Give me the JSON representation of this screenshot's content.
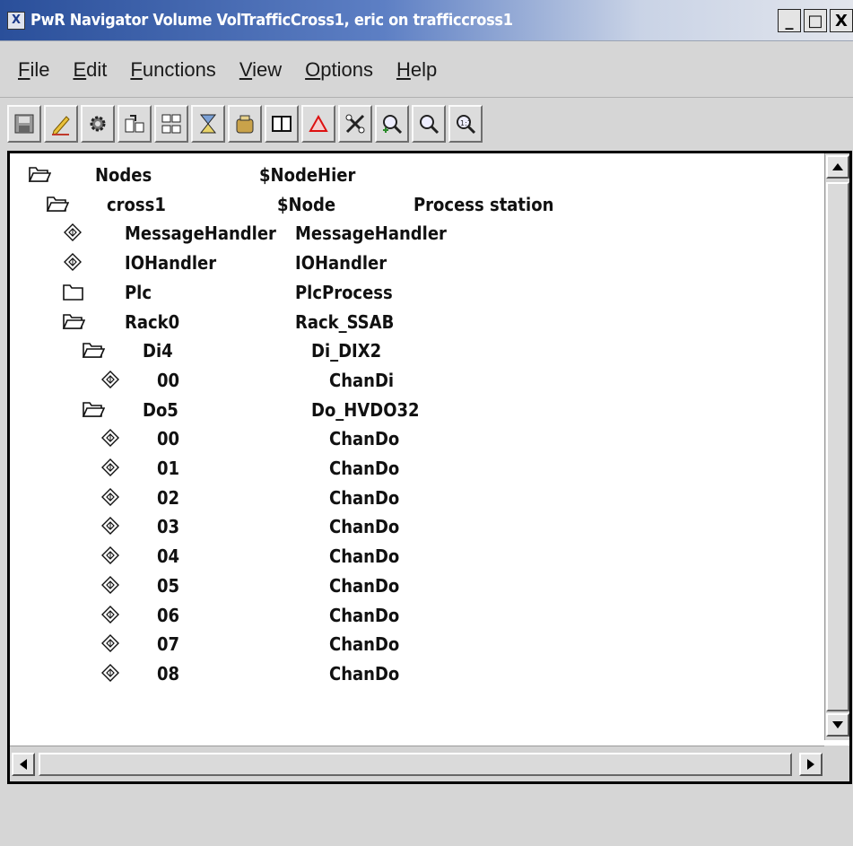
{
  "window": {
    "title": "PwR Navigator Volume VolTrafficCross1, eric on trafficcross1",
    "icon": "x-app-icon",
    "minimize": "_",
    "maximize": "□",
    "close": "X"
  },
  "menu": [
    {
      "underline": "F",
      "rest": "ile"
    },
    {
      "underline": "E",
      "rest": "dit"
    },
    {
      "underline": "F",
      "rest": "unctions"
    },
    {
      "underline": "V",
      "rest": "iew"
    },
    {
      "underline": "O",
      "rest": "ptions"
    },
    {
      "underline": "H",
      "rest": "elp"
    }
  ],
  "toolbar": [
    {
      "icon": "save-icon"
    },
    {
      "icon": "edit-pencil-icon"
    },
    {
      "icon": "gear-icon"
    },
    {
      "icon": "open-object-icon"
    },
    {
      "icon": "hierarchy-icon"
    },
    {
      "icon": "build-icon"
    },
    {
      "icon": "bucket-icon"
    },
    {
      "icon": "split-view-icon"
    },
    {
      "icon": "triangle-warning-icon"
    },
    {
      "icon": "tools-icon"
    },
    {
      "icon": "zoom-in-icon"
    },
    {
      "icon": "zoom-out-icon"
    },
    {
      "icon": "zoom-reset-icon"
    }
  ],
  "tree": [
    {
      "level": 0,
      "icon": "folder-open-icon",
      "name": "Nodes",
      "class": "$NodeHier",
      "desc": ""
    },
    {
      "level": 1,
      "icon": "folder-open-icon",
      "name": "cross1",
      "class": "$Node",
      "desc": "Process station"
    },
    {
      "level": 2,
      "icon": "leaf-object-icon",
      "name": "MessageHandler",
      "class": "MessageHandler",
      "desc": ""
    },
    {
      "level": 2,
      "icon": "leaf-object-icon",
      "name": "IOHandler",
      "class": "IOHandler",
      "desc": ""
    },
    {
      "level": 2,
      "icon": "folder-closed-icon",
      "name": "Plc",
      "class": "PlcProcess",
      "desc": ""
    },
    {
      "level": 2,
      "icon": "folder-open-icon",
      "name": "Rack0",
      "class": "Rack_SSAB",
      "desc": ""
    },
    {
      "level": 3,
      "icon": "folder-open-icon",
      "name": "Di4",
      "class": "Di_DIX2",
      "desc": ""
    },
    {
      "level": 4,
      "icon": "leaf-object-icon",
      "name": "00",
      "class": "ChanDi",
      "desc": ""
    },
    {
      "level": 3,
      "icon": "folder-open-icon",
      "name": "Do5",
      "class": "Do_HVDO32",
      "desc": ""
    },
    {
      "level": 4,
      "icon": "leaf-object-icon",
      "name": "00",
      "class": "ChanDo",
      "desc": ""
    },
    {
      "level": 4,
      "icon": "leaf-object-icon",
      "name": "01",
      "class": "ChanDo",
      "desc": ""
    },
    {
      "level": 4,
      "icon": "leaf-object-icon",
      "name": "02",
      "class": "ChanDo",
      "desc": ""
    },
    {
      "level": 4,
      "icon": "leaf-object-icon",
      "name": "03",
      "class": "ChanDo",
      "desc": ""
    },
    {
      "level": 4,
      "icon": "leaf-object-icon",
      "name": "04",
      "class": "ChanDo",
      "desc": ""
    },
    {
      "level": 4,
      "icon": "leaf-object-icon",
      "name": "05",
      "class": "ChanDo",
      "desc": ""
    },
    {
      "level": 4,
      "icon": "leaf-object-icon",
      "name": "06",
      "class": "ChanDo",
      "desc": ""
    },
    {
      "level": 4,
      "icon": "leaf-object-icon",
      "name": "07",
      "class": "ChanDo",
      "desc": ""
    },
    {
      "level": 4,
      "icon": "leaf-object-icon",
      "name": "08",
      "class": "ChanDo",
      "desc": ""
    }
  ],
  "scrollbars": {
    "up": "up-arrow-icon",
    "down": "down-arrow-icon",
    "left": "left-arrow-icon",
    "right": "right-arrow-icon"
  }
}
